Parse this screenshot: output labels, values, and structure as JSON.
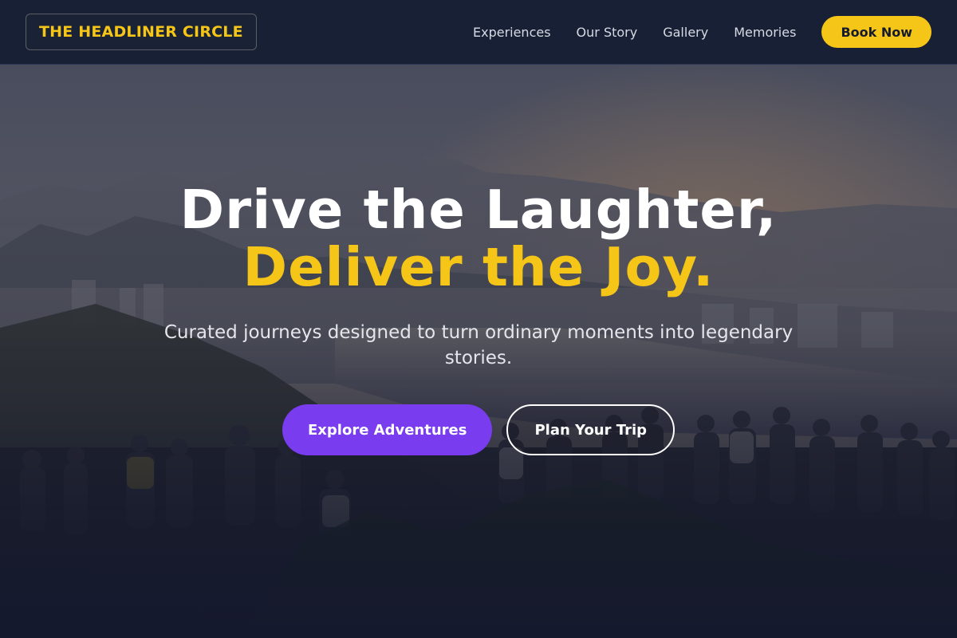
{
  "navbar": {
    "logo_text": "THE HEADLINER CIRCLE",
    "links": [
      "Experiences",
      "Our Story",
      "Gallery",
      "Memories"
    ],
    "cta_label": "Book Now"
  },
  "hero": {
    "headline_line1": "Drive the Laughter,",
    "headline_line2": "Deliver the Joy.",
    "subtitle": "Curated journeys designed to turn ordinary moments into legendary stories.",
    "primary_cta": "Explore Adventures",
    "secondary_cta": "Plan Your Trip",
    "background_description": "crowd-overlooking-coastal-city-at-sunset"
  },
  "colors": {
    "accent_yellow": "#f5c518",
    "accent_purple": "#7a3cef",
    "navbar_bg": "#182035",
    "page_bg": "#151b2e"
  }
}
